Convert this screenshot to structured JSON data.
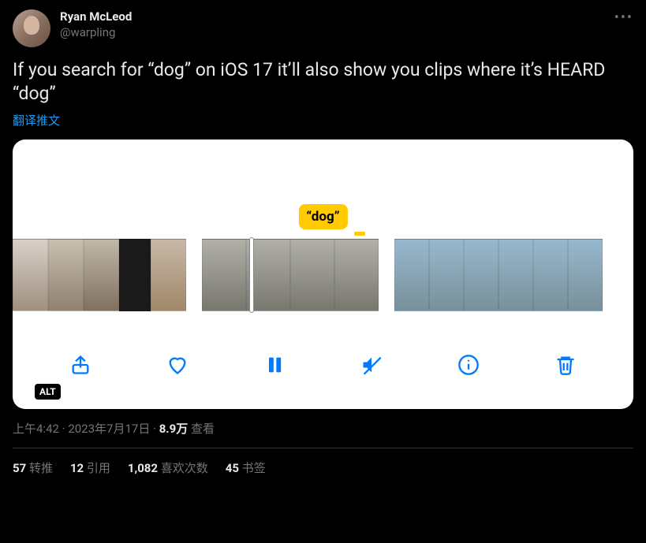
{
  "user": {
    "displayName": "Ryan McLeod",
    "handle": "@warpling"
  },
  "tweet": {
    "body": "If you search for “dog” on iOS 17 it’ll also show you clips where it’s HEARD “dog”",
    "translateLabel": "翻译推文"
  },
  "media": {
    "searchBadge": "“dog”",
    "altBadge": "ALT"
  },
  "meta": {
    "time": "上午4:42",
    "sep": " · ",
    "date": "2023年7月17日",
    "viewsCount": "8.9万",
    "viewsLabel": " 查看"
  },
  "stats": {
    "retweets": {
      "num": "57",
      "label": " 转推"
    },
    "quotes": {
      "num": "12",
      "label": " 引用"
    },
    "likes": {
      "num": "1,082",
      "label": " 喜欢次数"
    },
    "bookmarks": {
      "num": "45",
      "label": " 书签"
    }
  }
}
